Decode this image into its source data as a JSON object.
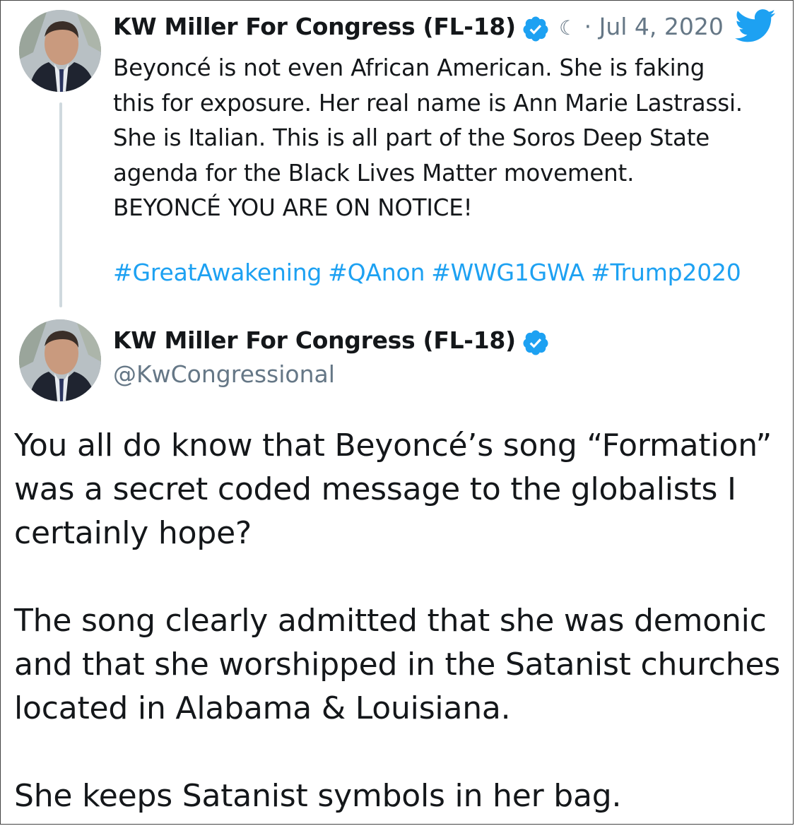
{
  "tweet1": {
    "display_name": "KW Miller For Congress (FL-18)",
    "moon_glyph": "☾",
    "separator": "·",
    "date": "Jul 4, 2020",
    "body_lines": [
      "Beyoncé is not even African American. She is faking",
      "this for exposure. Her real name is Ann Marie Lastrassi.",
      "She is Italian. This is all part of the Soros Deep State",
      "agenda for the Black Lives Matter movement.",
      "BEYONCÉ YOU ARE ON NOTICE!"
    ],
    "hashtags": [
      "#GreatAwakening",
      "#QAnon",
      "#WWG1GWA",
      "#Trump2020"
    ]
  },
  "tweet2": {
    "display_name": "KW Miller For Congress (FL-18)",
    "handle": "@KwCongressional",
    "paragraphs": [
      [
        "You all do know that Beyoncé’s song “Formation”",
        "was a secret coded message to the globalists I",
        "certainly hope?"
      ],
      [
        "The song clearly admitted that she was demonic",
        "and that she worshipped in the Satanist churches",
        "located in Alabama & Louisiana."
      ],
      [
        "She keeps Satanist symbols in her bag."
      ]
    ]
  },
  "icons": {
    "verified": "verified-badge-icon",
    "brand": "twitter-bird-icon",
    "avatar": "profile-photo"
  },
  "colors": {
    "text": "#14171a",
    "muted": "#657786",
    "link": "#1da1f2",
    "verified": "#1da1f2",
    "thread_line": "#cfd9de"
  }
}
